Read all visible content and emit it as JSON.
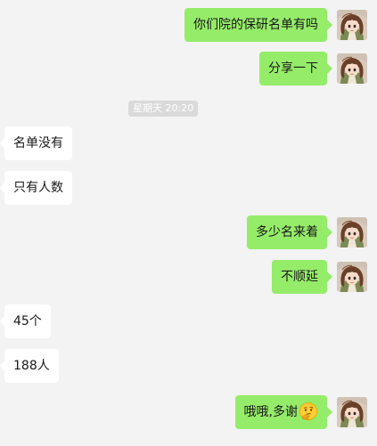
{
  "messages": [
    {
      "side": "me",
      "text": "你们院的保研名单有吗"
    },
    {
      "side": "me",
      "text": "分享一下"
    },
    {
      "side": "them",
      "text": "名单没有"
    },
    {
      "side": "them",
      "text": "只有人数"
    },
    {
      "side": "me",
      "text": "多少名来着"
    },
    {
      "side": "me",
      "text": "不顺延"
    },
    {
      "side": "them",
      "text": "45个"
    },
    {
      "side": "them",
      "text": "188人"
    },
    {
      "side": "me",
      "text": "哦哦,多谢",
      "emoji": "thinking-face-emoji"
    }
  ],
  "timestamp": "星期天 20:20",
  "colors": {
    "outgoing_bubble": "#95ec69",
    "incoming_bubble": "#ffffff",
    "background": "#f3f3f3",
    "timestamp_bg": "#dadada"
  },
  "icons": {
    "avatar": "anime-girl-avatar",
    "emoji": "thinking-face-emoji"
  }
}
